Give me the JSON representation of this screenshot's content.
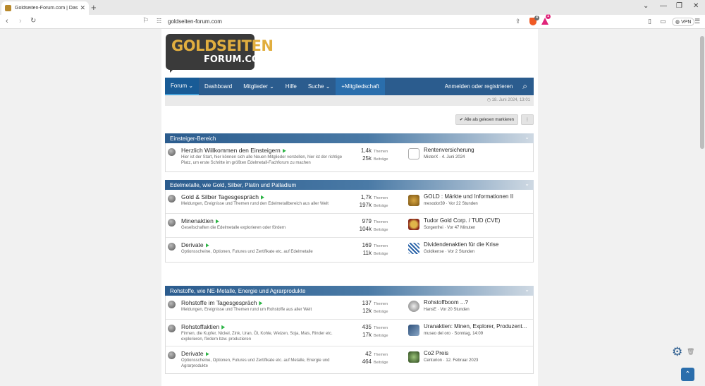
{
  "browser": {
    "tab_title": "Goldseiten-Forum.com | Das Di...",
    "tab_close": "✕",
    "new_tab": "+",
    "url": "goldseiten-forum.com",
    "brave_badge": "4",
    "rewards_badge": "1",
    "vpn_label": "VPN"
  },
  "logo": {
    "line1": "GOLDSEITEN",
    "line2": "FORUM.COM"
  },
  "navbar": {
    "items": [
      {
        "label": "Forum ⌄"
      },
      {
        "label": "Dashboard"
      },
      {
        "label": "Mitglieder ⌄"
      },
      {
        "label": "Hilfe"
      },
      {
        "label": "Suche ⌄"
      },
      {
        "label": "+Mitgliedschaft"
      }
    ],
    "login": "Anmelden oder registrieren"
  },
  "subbar": {
    "date": "18. Juni 2024, 13:01"
  },
  "actions": {
    "mark_read": "Alle als gelesen markieren",
    "more": "⋮"
  },
  "sections": [
    {
      "title": "Einsteiger-Bereich",
      "rows": [
        {
          "title": "Herzlich Willkommen den Einsteigern",
          "desc": "Hier ist der Start, hier können sich alle Neuen Mitglieder vorstellen, hier ist der richtige Platz, um erste Schritte im größten Edelmetall-Fachforum zu machen",
          "themen": "1,4k",
          "beitraege": "25k",
          "latest_title": "Rentenversicherung",
          "latest_user": "MisterX",
          "latest_time": "4. Juni 2024"
        }
      ]
    },
    {
      "title": "Edelmetalle, wie Gold, Silber, Platin und Palladium",
      "rows": [
        {
          "title": "Gold & Silber Tagesgespräch",
          "desc": "Meldungen, Ereignisse und Themen rund den Edelmetallbereich aus aller Welt",
          "themen": "1,7k",
          "beitraege": "197k",
          "latest_title": "GOLD : Märkte und Informationen II",
          "latest_user": "mesodor39",
          "latest_time": "Vor 22 Stunden"
        },
        {
          "title": "Minenaktien",
          "desc": "Gesellschaften die Edelmetalle explorieren oder fördern",
          "themen": "979",
          "beitraege": "104k",
          "latest_title": "Tudor Gold Corp. / TUD (CVE)",
          "latest_user": "Sorgenfrei",
          "latest_time": "Vor 47 Minuten"
        },
        {
          "title": "Derivate",
          "desc": "Optionsscheine, Optionen, Futures und Zertifikate etc. auf Edelmetalle",
          "themen": "169",
          "beitraege": "11k",
          "latest_title": "Dividendenaktien für die Krise",
          "latest_user": "Goldkense",
          "latest_time": "Vor 2 Stunden"
        }
      ]
    },
    {
      "title": "Rohstoffe, wie NE-Metalle, Energie und Agrarprodukte",
      "rows": [
        {
          "title": "Rohstoffe im Tagesgespräch",
          "desc": "Meldungen, Ereignisse und Themen rund um Rohstoffe aus aller Welt",
          "themen": "137",
          "beitraege": "12k",
          "latest_title": "Rohstoffboom ...?",
          "latest_user": "HansE",
          "latest_time": "Vor 20 Stunden"
        },
        {
          "title": "Rohstoffaktien",
          "desc": "Firmen, die Kupfer, Nickel, Zink, Uran, Öl, Kohle, Weizen, Soja, Mais, Rinder etc. explorieren, fördern bzw. produzieren",
          "themen": "435",
          "beitraege": "17k",
          "latest_title": "Uranaktien: Minen, Explorer, Produzent...",
          "latest_user": "museo del oro",
          "latest_time": "Sonntag, 14:09"
        },
        {
          "title": "Derivate",
          "desc": "Optionsscheine, Optionen, Futures und Zertifikate etc. auf Metalle, Energie und Agrarprodukte",
          "themen": "42",
          "beitraege": "464",
          "latest_title": "Co2 Preis",
          "latest_user": "Centurion",
          "latest_time": "12. Februar 2023"
        }
      ]
    }
  ],
  "labels": {
    "themen": "Themen",
    "beitraege": "Beiträge",
    "sep": "·"
  },
  "colors": {
    "brand_blue": "#2b5c8e",
    "rss_green": "#2db446",
    "gold": "#e1ae3f"
  }
}
